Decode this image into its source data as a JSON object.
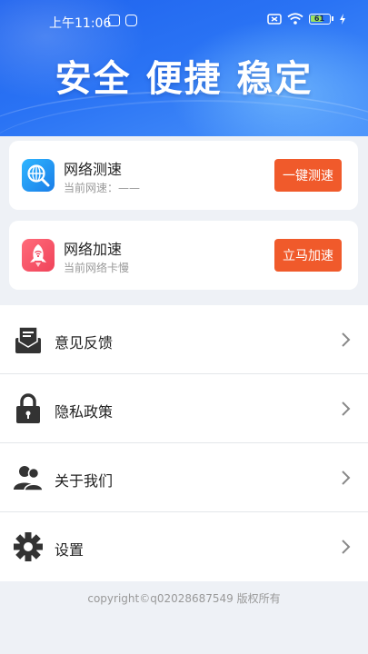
{
  "status_bar": {
    "time": "上午11:06",
    "battery": "61"
  },
  "hero": {
    "title": "安全 便捷 稳定"
  },
  "cards": [
    {
      "title": "网络测速",
      "subtitle": "当前网速：——",
      "button": "一键测速",
      "icon": "speed-test-icon"
    },
    {
      "title": "网络加速",
      "subtitle": "当前网络卡慢",
      "button": "立马加速",
      "icon": "rocket-icon"
    }
  ],
  "menu": [
    {
      "label": "意见反馈",
      "icon": "feedback-icon"
    },
    {
      "label": "隐私政策",
      "icon": "lock-icon"
    },
    {
      "label": "关于我们",
      "icon": "users-icon"
    },
    {
      "label": "设置",
      "icon": "gear-icon"
    }
  ],
  "footer": {
    "copyright": "copyright©q02028687549 版权所有"
  },
  "colors": {
    "accent_button": "#f05a2b",
    "hero_blue": "#2a73f4",
    "background": "#eef1f6"
  }
}
